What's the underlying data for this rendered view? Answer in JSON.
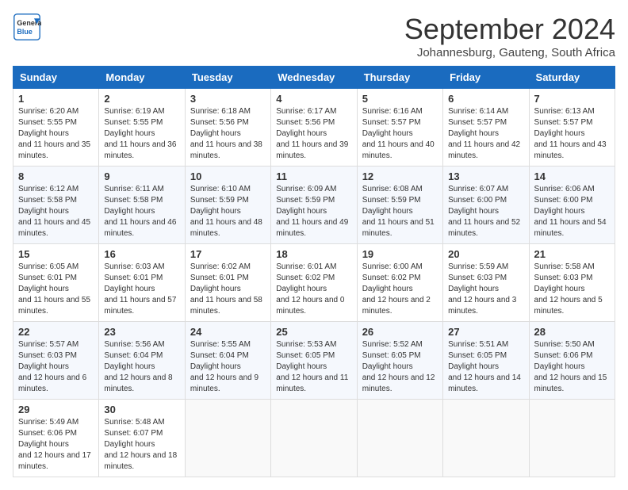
{
  "header": {
    "logo_text_top": "General",
    "logo_text_bottom": "Blue",
    "month": "September 2024",
    "location": "Johannesburg, Gauteng, South Africa"
  },
  "weekdays": [
    "Sunday",
    "Monday",
    "Tuesday",
    "Wednesday",
    "Thursday",
    "Friday",
    "Saturday"
  ],
  "weeks": [
    [
      {
        "day": "1",
        "sunrise": "6:20 AM",
        "sunset": "5:55 PM",
        "daylight": "11 hours and 35 minutes."
      },
      {
        "day": "2",
        "sunrise": "6:19 AM",
        "sunset": "5:55 PM",
        "daylight": "11 hours and 36 minutes."
      },
      {
        "day": "3",
        "sunrise": "6:18 AM",
        "sunset": "5:56 PM",
        "daylight": "11 hours and 38 minutes."
      },
      {
        "day": "4",
        "sunrise": "6:17 AM",
        "sunset": "5:56 PM",
        "daylight": "11 hours and 39 minutes."
      },
      {
        "day": "5",
        "sunrise": "6:16 AM",
        "sunset": "5:57 PM",
        "daylight": "11 hours and 40 minutes."
      },
      {
        "day": "6",
        "sunrise": "6:14 AM",
        "sunset": "5:57 PM",
        "daylight": "11 hours and 42 minutes."
      },
      {
        "day": "7",
        "sunrise": "6:13 AM",
        "sunset": "5:57 PM",
        "daylight": "11 hours and 43 minutes."
      }
    ],
    [
      {
        "day": "8",
        "sunrise": "6:12 AM",
        "sunset": "5:58 PM",
        "daylight": "11 hours and 45 minutes."
      },
      {
        "day": "9",
        "sunrise": "6:11 AM",
        "sunset": "5:58 PM",
        "daylight": "11 hours and 46 minutes."
      },
      {
        "day": "10",
        "sunrise": "6:10 AM",
        "sunset": "5:59 PM",
        "daylight": "11 hours and 48 minutes."
      },
      {
        "day": "11",
        "sunrise": "6:09 AM",
        "sunset": "5:59 PM",
        "daylight": "11 hours and 49 minutes."
      },
      {
        "day": "12",
        "sunrise": "6:08 AM",
        "sunset": "5:59 PM",
        "daylight": "11 hours and 51 minutes."
      },
      {
        "day": "13",
        "sunrise": "6:07 AM",
        "sunset": "6:00 PM",
        "daylight": "11 hours and 52 minutes."
      },
      {
        "day": "14",
        "sunrise": "6:06 AM",
        "sunset": "6:00 PM",
        "daylight": "11 hours and 54 minutes."
      }
    ],
    [
      {
        "day": "15",
        "sunrise": "6:05 AM",
        "sunset": "6:01 PM",
        "daylight": "11 hours and 55 minutes."
      },
      {
        "day": "16",
        "sunrise": "6:03 AM",
        "sunset": "6:01 PM",
        "daylight": "11 hours and 57 minutes."
      },
      {
        "day": "17",
        "sunrise": "6:02 AM",
        "sunset": "6:01 PM",
        "daylight": "11 hours and 58 minutes."
      },
      {
        "day": "18",
        "sunrise": "6:01 AM",
        "sunset": "6:02 PM",
        "daylight": "12 hours and 0 minutes."
      },
      {
        "day": "19",
        "sunrise": "6:00 AM",
        "sunset": "6:02 PM",
        "daylight": "12 hours and 2 minutes."
      },
      {
        "day": "20",
        "sunrise": "5:59 AM",
        "sunset": "6:03 PM",
        "daylight": "12 hours and 3 minutes."
      },
      {
        "day": "21",
        "sunrise": "5:58 AM",
        "sunset": "6:03 PM",
        "daylight": "12 hours and 5 minutes."
      }
    ],
    [
      {
        "day": "22",
        "sunrise": "5:57 AM",
        "sunset": "6:03 PM",
        "daylight": "12 hours and 6 minutes."
      },
      {
        "day": "23",
        "sunrise": "5:56 AM",
        "sunset": "6:04 PM",
        "daylight": "12 hours and 8 minutes."
      },
      {
        "day": "24",
        "sunrise": "5:55 AM",
        "sunset": "6:04 PM",
        "daylight": "12 hours and 9 minutes."
      },
      {
        "day": "25",
        "sunrise": "5:53 AM",
        "sunset": "6:05 PM",
        "daylight": "12 hours and 11 minutes."
      },
      {
        "day": "26",
        "sunrise": "5:52 AM",
        "sunset": "6:05 PM",
        "daylight": "12 hours and 12 minutes."
      },
      {
        "day": "27",
        "sunrise": "5:51 AM",
        "sunset": "6:05 PM",
        "daylight": "12 hours and 14 minutes."
      },
      {
        "day": "28",
        "sunrise": "5:50 AM",
        "sunset": "6:06 PM",
        "daylight": "12 hours and 15 minutes."
      }
    ],
    [
      {
        "day": "29",
        "sunrise": "5:49 AM",
        "sunset": "6:06 PM",
        "daylight": "12 hours and 17 minutes."
      },
      {
        "day": "30",
        "sunrise": "5:48 AM",
        "sunset": "6:07 PM",
        "daylight": "12 hours and 18 minutes."
      },
      null,
      null,
      null,
      null,
      null
    ]
  ]
}
